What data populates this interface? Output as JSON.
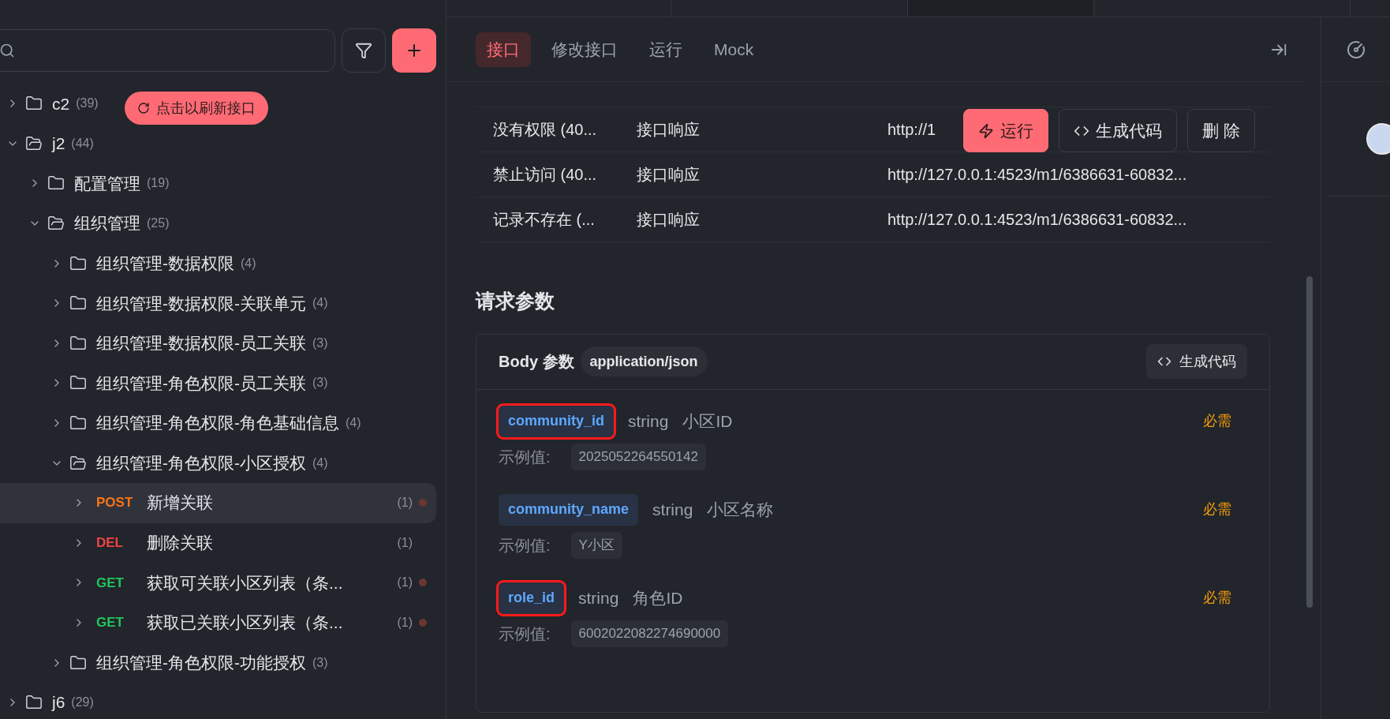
{
  "sidebar": {
    "refresh_tip": "点击以刷新接口",
    "tree": [
      {
        "kind": "folder",
        "name": "c2",
        "count": "(39)",
        "expanded": false
      },
      {
        "kind": "folder",
        "name": "j2",
        "count": "(44)",
        "expanded": true,
        "children": [
          {
            "kind": "folder",
            "name": "配置管理",
            "count": "(19)",
            "expanded": false
          },
          {
            "kind": "folder",
            "name": "组织管理",
            "count": "(25)",
            "expanded": true,
            "children": [
              {
                "kind": "folder",
                "name": "组织管理-数据权限",
                "count": "(4)",
                "expanded": false
              },
              {
                "kind": "folder",
                "name": "组织管理-数据权限-关联单元",
                "count": "(4)",
                "expanded": false
              },
              {
                "kind": "folder",
                "name": "组织管理-数据权限-员工关联",
                "count": "(3)",
                "expanded": false
              },
              {
                "kind": "folder",
                "name": "组织管理-角色权限-员工关联",
                "count": "(3)",
                "expanded": false
              },
              {
                "kind": "folder",
                "name": "组织管理-角色权限-角色基础信息",
                "count": "(4)",
                "expanded": false
              },
              {
                "kind": "folder",
                "name": "组织管理-角色权限-小区授权",
                "count": "(4)",
                "expanded": true,
                "children": [
                  {
                    "kind": "endpoint",
                    "method": "POST",
                    "name": "新增关联",
                    "count": "(1)",
                    "selected": true,
                    "unsaved": true
                  },
                  {
                    "kind": "endpoint",
                    "method": "DEL",
                    "name": "删除关联",
                    "count": "(1)",
                    "selected": false,
                    "unsaved": false
                  },
                  {
                    "kind": "endpoint",
                    "method": "GET",
                    "name": "获取可关联小区列表（条...",
                    "count": "(1)",
                    "selected": false,
                    "unsaved": true
                  },
                  {
                    "kind": "endpoint",
                    "method": "GET",
                    "name": "获取已关联小区列表（条...",
                    "count": "(1)",
                    "selected": false,
                    "unsaved": true
                  }
                ]
              },
              {
                "kind": "folder",
                "name": "组织管理-角色权限-功能授权",
                "count": "(3)",
                "expanded": false
              }
            ]
          }
        ]
      },
      {
        "kind": "folder",
        "name": "j6",
        "count": "(29)",
        "expanded": false
      }
    ]
  },
  "tabs": [
    {
      "label": "接口",
      "selected": true
    },
    {
      "label": "修改接口",
      "selected": false
    },
    {
      "label": "运行",
      "selected": false
    },
    {
      "label": "Mock",
      "selected": false
    }
  ],
  "responses": [
    {
      "name": "没有权限 (40...",
      "type": "接口响应",
      "url": "http://1"
    },
    {
      "name": "禁止访问 (40...",
      "type": "接口响应",
      "url": "http://127.0.0.1:4523/m1/6386631-60832..."
    },
    {
      "name": "记录不存在 (...",
      "type": "接口响应",
      "url": "http://127.0.0.1:4523/m1/6386631-60832..."
    }
  ],
  "row_actions": [
    {
      "kind": "run",
      "label": "运行"
    },
    {
      "kind": "code",
      "label": "生成代码"
    },
    {
      "kind": "delete",
      "label": "删 除"
    }
  ],
  "request_params": {
    "title": "请求参数",
    "body_label": "Body 参数",
    "content_type": "application/json",
    "generate_code": "生成代码",
    "params": [
      {
        "name": "community_id",
        "type": "string",
        "description": "小区ID",
        "required": "必需",
        "example_label": "示例值:",
        "example": "2025052264550142",
        "highlighted": true
      },
      {
        "name": "community_name",
        "type": "string",
        "description": "小区名称",
        "required": "必需",
        "example_label": "示例值:",
        "example": "Y小区",
        "highlighted": false
      },
      {
        "name": "role_id",
        "type": "string",
        "description": "角色ID",
        "required": "必需",
        "example_label": "示例值:",
        "example": "6002022082274690000",
        "highlighted": true
      }
    ]
  }
}
